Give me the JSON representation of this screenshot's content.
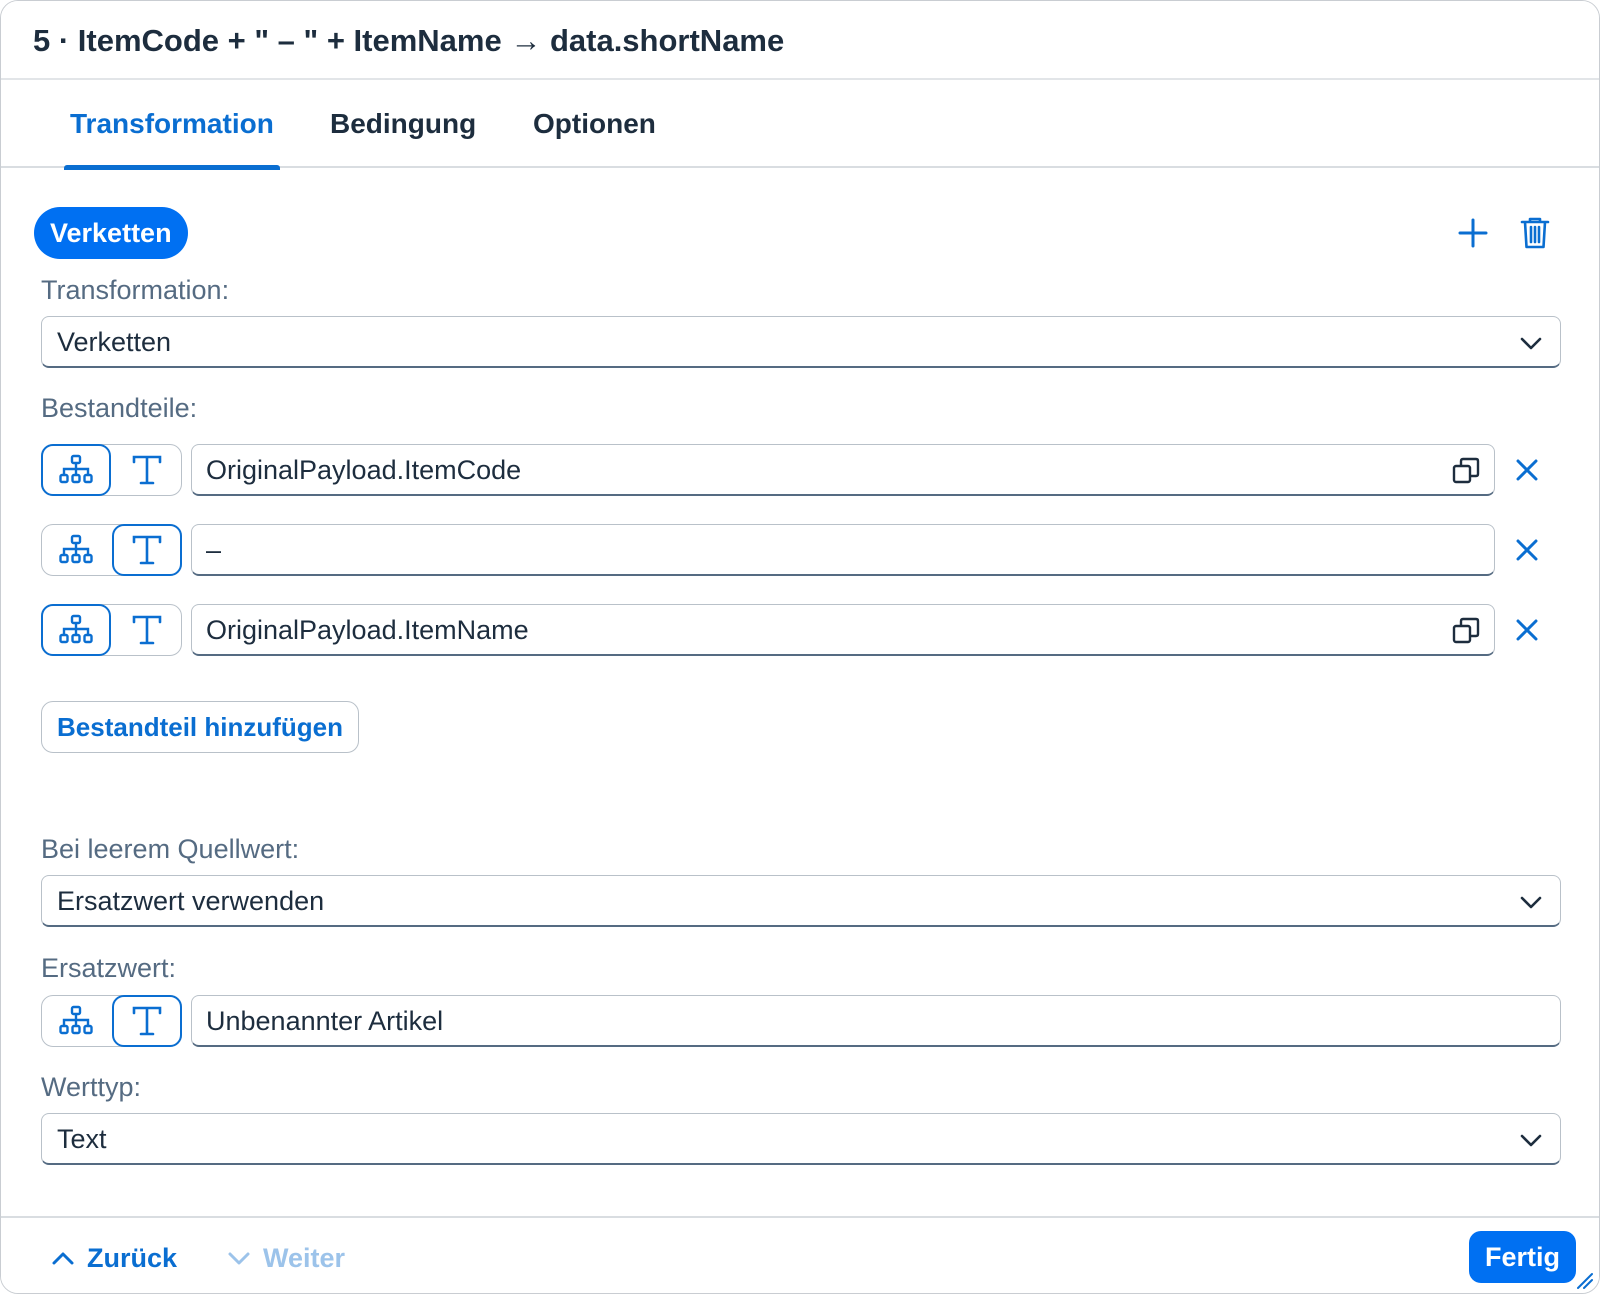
{
  "dialog": {
    "title": "5 · ItemCode + \" – \" + ItemName → data.shortName"
  },
  "tabs": [
    {
      "label": "Transformation",
      "active": true
    },
    {
      "label": "Bedingung",
      "active": false
    },
    {
      "label": "Optionen",
      "active": false
    }
  ],
  "transformation_step": {
    "chip_label": "Verketten",
    "add_icon": "plus-icon",
    "delete_icon": "trash-icon"
  },
  "transformation_field": {
    "label": "Transformation:",
    "value": "Verketten"
  },
  "components": {
    "label": "Bestandteile:",
    "items": [
      {
        "mode": "path",
        "value": "OriginalPayload.ItemCode",
        "has_copy": true
      },
      {
        "mode": "text",
        "value": "–",
        "has_copy": false
      },
      {
        "mode": "path",
        "value": "OriginalPayload.ItemName",
        "has_copy": true
      }
    ],
    "add_label": "Bestandteil hinzufügen"
  },
  "empty_source": {
    "label": "Bei leerem Quellwert:",
    "value": "Ersatzwert verwenden"
  },
  "fallback": {
    "label": "Ersatzwert:",
    "mode": "text",
    "value": "Unbenannter Artikel"
  },
  "value_type": {
    "label": "Werttyp:",
    "value": "Text"
  },
  "footer": {
    "back_label": "Zurück",
    "next_label": "Weiter",
    "next_enabled": false,
    "done_label": "Fertig"
  },
  "colors": {
    "accent": "#0a6ed1",
    "primary_button": "#0070f2",
    "text": "#1d2d3e",
    "label": "#556b82"
  }
}
